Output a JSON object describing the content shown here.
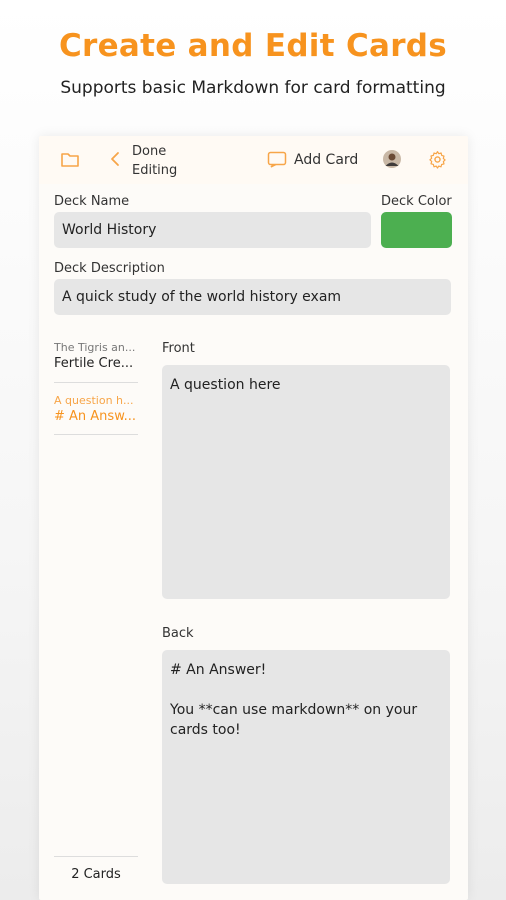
{
  "hero": {
    "title": "Create and Edit Cards",
    "subtitle": "Supports basic Markdown for card formatting"
  },
  "toolbar": {
    "folder_icon": "folder-icon",
    "back_icon": "chevron-left-icon",
    "done_line1": "Done",
    "done_line2": "Editing",
    "add_card_icon": "add-card-icon",
    "add_card_label": "Add Card",
    "settings_icon": "gear-icon",
    "accent": "#f7931e"
  },
  "deck": {
    "name_label": "Deck Name",
    "name_value": "World History",
    "color_label": "Deck Color",
    "color_value": "#4caf50",
    "desc_label": "Deck Description",
    "desc_value": "A quick study of the world history exam"
  },
  "sidebar": {
    "items": [
      {
        "question": "The Tigris an...",
        "answer": "Fertile Cre...",
        "active": false
      },
      {
        "question": "A question h...",
        "answer": "# An Answ...",
        "active": true
      }
    ],
    "count_label": "2 Cards"
  },
  "editor": {
    "front_label": "Front",
    "front_value": "A question here",
    "back_label": "Back",
    "back_value": "# An Answer!\n\nYou **can use markdown** on your cards too!"
  }
}
